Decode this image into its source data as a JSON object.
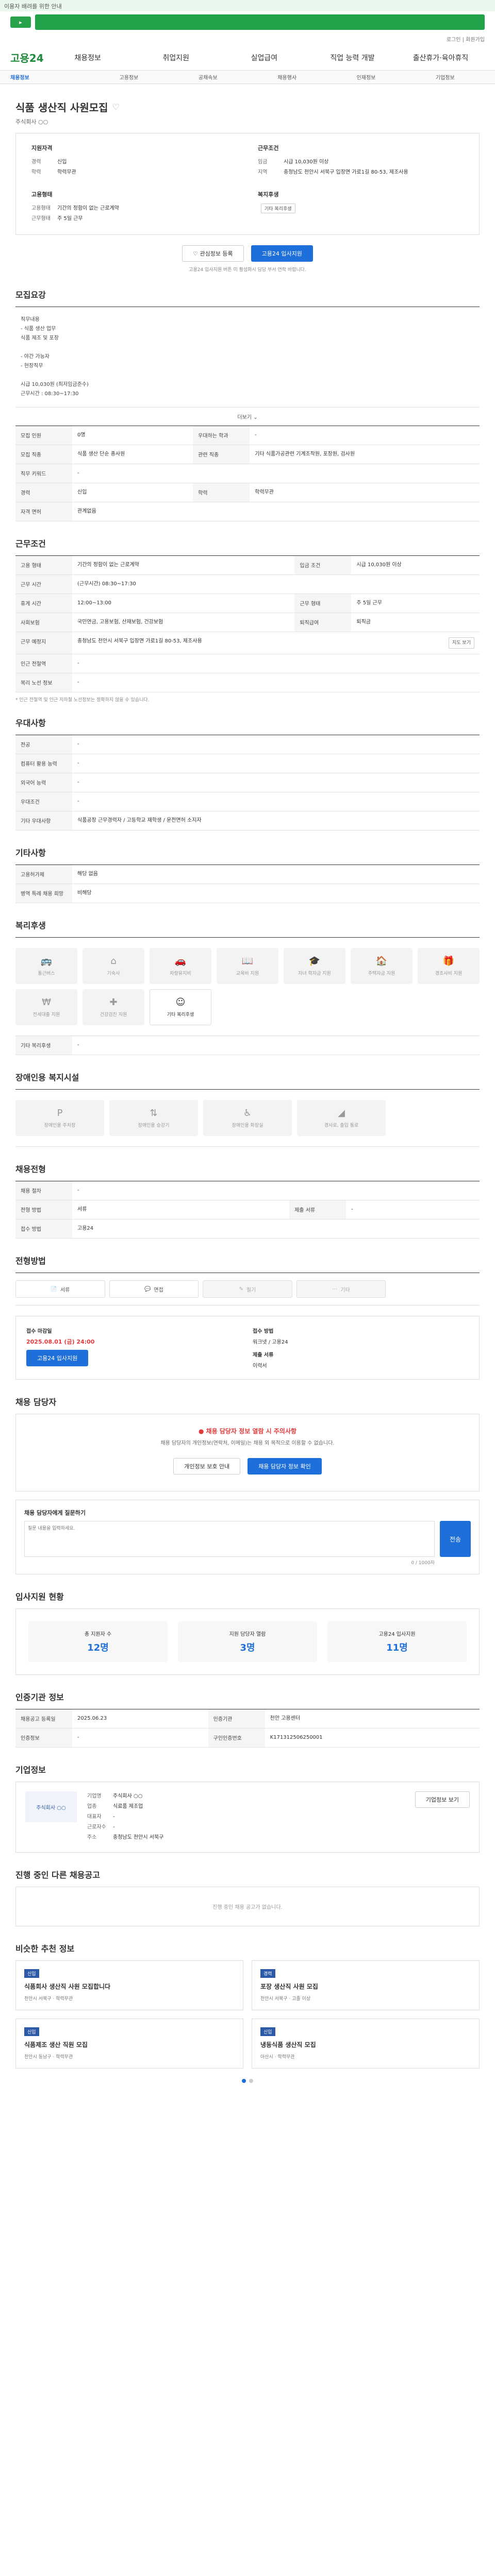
{
  "banner": "이용자 배려를 위한 안내",
  "top_links": "로그인 | 회원가입",
  "logo": "고용24",
  "nav": [
    "채용정보",
    "취업지원",
    "실업급여",
    "직업 능력 개발",
    "출산휴가·육아휴직"
  ],
  "subnav": [
    "채용정보",
    "고용정보",
    "공채속보",
    "채용행사",
    "인재정보",
    "기업정보"
  ],
  "job": {
    "title": "식품 생산직 사원모집",
    "org": "주식회사 ○○",
    "sum_left_h": "지원자격",
    "sum_left": [
      [
        "경력",
        "신입"
      ],
      [
        "학력",
        "학력무관"
      ]
    ],
    "sum_right_h": "근무조건",
    "sum_right": [
      [
        "임금",
        "시급 10,030원 이상"
      ],
      [
        "지역",
        "충청남도 천안시 서북구 입장면 가로1길 80-53, 제조사용"
      ]
    ],
    "sum_left2_h": "고용형태",
    "sum_left2": [
      [
        "고용형태",
        "기간의 정함이 없는 근로계약"
      ],
      [
        "근무형태",
        "주 5일 근무"
      ]
    ],
    "sum_right2_h": "복지후생",
    "sum_right2_tag": "기타 복리후생",
    "btn_scrap": "관심정보 등록",
    "btn_apply": "고용24 입사지원",
    "note": "고용24 입사지원 버튼 미 활성화시 담당 부서 연락 바랍니다."
  },
  "detail": {
    "title": "모집요강",
    "lines": [
      "직무내용",
      "- 식품 생산 업무",
      "식품 제조 및 포장",
      "",
      "- 야간 가능자",
      "- 현장직무",
      "",
      "시급 10,030원 (최저임금준수)",
      "근무시간 : 08:30~17:30"
    ],
    "more": "더보기"
  },
  "recruit_table": [
    [
      "모집 인원",
      "0명",
      "우대하는 학과",
      "-"
    ],
    [
      "모집 직종",
      "식품 생산 단순 종사원",
      "관련 직종",
      "기타 식품가공관련 기계조작원, 포장원, 검사원"
    ],
    [
      "직무 키워드",
      "-",
      "",
      ""
    ],
    [
      "경력",
      "신입",
      "학력",
      "학력무관"
    ],
    [
      "자격 면허",
      "관계없음",
      "",
      ""
    ]
  ],
  "cond": {
    "title": "근무조건",
    "rows": [
      [
        "고용 형태",
        "기간의 정함이 없는 근로계약",
        "입금 조건",
        "시급 10,030원 이상"
      ],
      [
        "근무 시간",
        "(근무시간) 08:30~17:30",
        "",
        ""
      ],
      [
        "휴게 시간",
        "12:00~13:00",
        "근무 형태",
        "주 5일 근무"
      ],
      [
        "사회보험",
        "국민연금, 고용보험, 산재보험, 건강보험",
        "퇴직급여",
        "퇴직금"
      ],
      [
        "근무 예정지",
        "충청남도 천안시 서북구 입장면 가로1길 80-53, 제조사용",
        "",
        ""
      ],
      [
        "인근 전철역",
        "-",
        "",
        ""
      ],
      [
        "복리 노선 정보",
        "-",
        "",
        ""
      ]
    ],
    "map_btn": "지도 보기",
    "note": "* 인근 전철역 및 인근 지하철 노선정보는 정확하지 않을 수 있습니다."
  },
  "pref": {
    "title": "우대사항",
    "rows": [
      [
        "전공",
        "-"
      ],
      [
        "컴퓨터 활용 능력",
        "-"
      ],
      [
        "외국어 능력",
        "-"
      ],
      [
        "우대조건",
        "-"
      ],
      [
        "기타 우대사항",
        "식품공장 근무경력자 / 고등학교 재학생 / 운전면허 소지자"
      ]
    ]
  },
  "etc": {
    "title": "기타사항",
    "rows": [
      [
        "고용허가제",
        "해당 없음"
      ],
      [
        "병역 특례 채용 희망",
        "비해당"
      ]
    ]
  },
  "welfare": {
    "title": "복리후생",
    "items": [
      "통근버스",
      "기숙사",
      "차량유지비",
      "교육비 지원",
      "자녀 학자금 지원",
      "주택자금 지원",
      "경조사비 지원",
      "전세대출 지원",
      "건강검진 지원",
      "기타 복리후생"
    ],
    "etc_label": "기타 복리후생"
  },
  "disabled": {
    "title": "장애인용 복지시설",
    "items": [
      "장애인용 주차장",
      "장애인용 승강기",
      "장애인용 화장실",
      "경사로, 출입 통로"
    ]
  },
  "process": {
    "title": "채용전형",
    "rows": [
      [
        "채용 절차",
        "-",
        "",
        ""
      ],
      [
        "전형 방법",
        "서류",
        "제출 서류",
        "-"
      ],
      [
        "접수 방법",
        "고용24",
        "",
        ""
      ]
    ]
  },
  "tools": {
    "title": "전형방법",
    "items": [
      "서류",
      "면접",
      "필기",
      "기타"
    ]
  },
  "apply": {
    "period_label": "접수 마감일",
    "period": "2025.08.01 (금) 24:00",
    "method_label": "접수 방법",
    "method": "워크넷 / 고용24",
    "btn": "고용24 입사지원",
    "docs_label": "제출 서류",
    "docs": "이력서"
  },
  "contact": {
    "title": "채용 담당자",
    "alert": "채용 담당자 정보 열람 시 주의사항",
    "lines": [
      "채용 담당자의 개인정보(연락처, 이메일)는 채용 외 목적으로 이용할 수 없습니다."
    ],
    "btn_view": "채용 담당자 정보 확인",
    "btn_info": "개인정보 보호 안내"
  },
  "qa": {
    "title": "채용 담당자에게 질문하기",
    "placeholder": "질문 내용을 입력하세요.",
    "send": "전송",
    "counter": "0 / 1000자"
  },
  "stats": {
    "title": "입사지원 현황",
    "items": [
      [
        "총 지원자 수",
        "12명"
      ],
      [
        "지원 담당자 열람",
        "3명"
      ],
      [
        "고용24 입사지원",
        "11명"
      ]
    ]
  },
  "info2": {
    "title": "인증기관 정보",
    "rows": [
      [
        "채용공고 등록일",
        "2025.06.23",
        "인증기관",
        "천안 고용센터"
      ],
      [
        "인증정보",
        "-",
        "구인인증번호",
        "K171312506250001"
      ]
    ]
  },
  "company": {
    "title": "기업정보",
    "logo": "주식회사 ○○",
    "rows": [
      [
        "기업명",
        "주식회사 ○○"
      ],
      [
        "업종",
        "식료품 제조업"
      ],
      [
        "대표자",
        "-"
      ],
      [
        "근로자수",
        "-"
      ],
      [
        "주소",
        "충청남도 천안시 서북구"
      ]
    ],
    "btn": "기업정보 보기"
  },
  "similar": {
    "title": "진행 중인 다른 채용공고",
    "empty": "진행 중인 채용 공고가 없습니다."
  },
  "rec": {
    "title": "비슷한 추천 정보",
    "items": [
      [
        "신입",
        "식품회사 생산직 사원 모집합니다",
        "천안시 서북구 · 학력무관"
      ],
      [
        "경력",
        "포장 생산직 사원 모집",
        "천안시 서북구 · 고졸 이상"
      ],
      [
        "신입",
        "식품제조 생산 직원 모집",
        "천안시 동남구 · 학력무관"
      ],
      [
        "신입",
        "냉동식품 생산직 모집",
        "아산시 · 학력무관"
      ]
    ]
  }
}
